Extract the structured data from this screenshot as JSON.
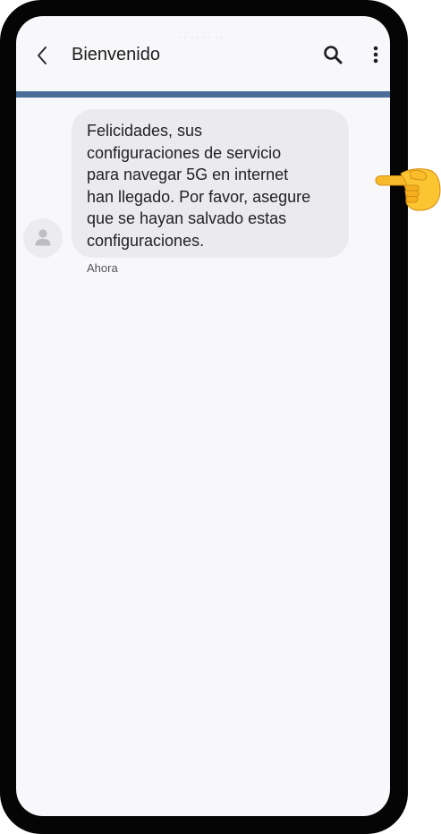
{
  "header": {
    "title": "Bienvenido",
    "back_icon": "chevron-left-icon",
    "search_icon": "search-icon",
    "more_icon": "more-vertical-icon"
  },
  "conversation": {
    "avatar_icon": "person-icon",
    "messages": [
      {
        "text": "Felicidades, sus\nconfiguraciones de servicio\npara navegar 5G en internet\nhan llegado. Por favor, asegure\nque se hayan salvado estas\nconfiguraciones.",
        "time": "Ahora"
      }
    ]
  },
  "annotation": {
    "icon": "pointing-hand-icon"
  },
  "colors": {
    "frame": "#050505",
    "screen_bg": "#f8f8fb",
    "bubble_bg": "#ebebee",
    "divider": "#4b6e99",
    "text": "#222226"
  }
}
